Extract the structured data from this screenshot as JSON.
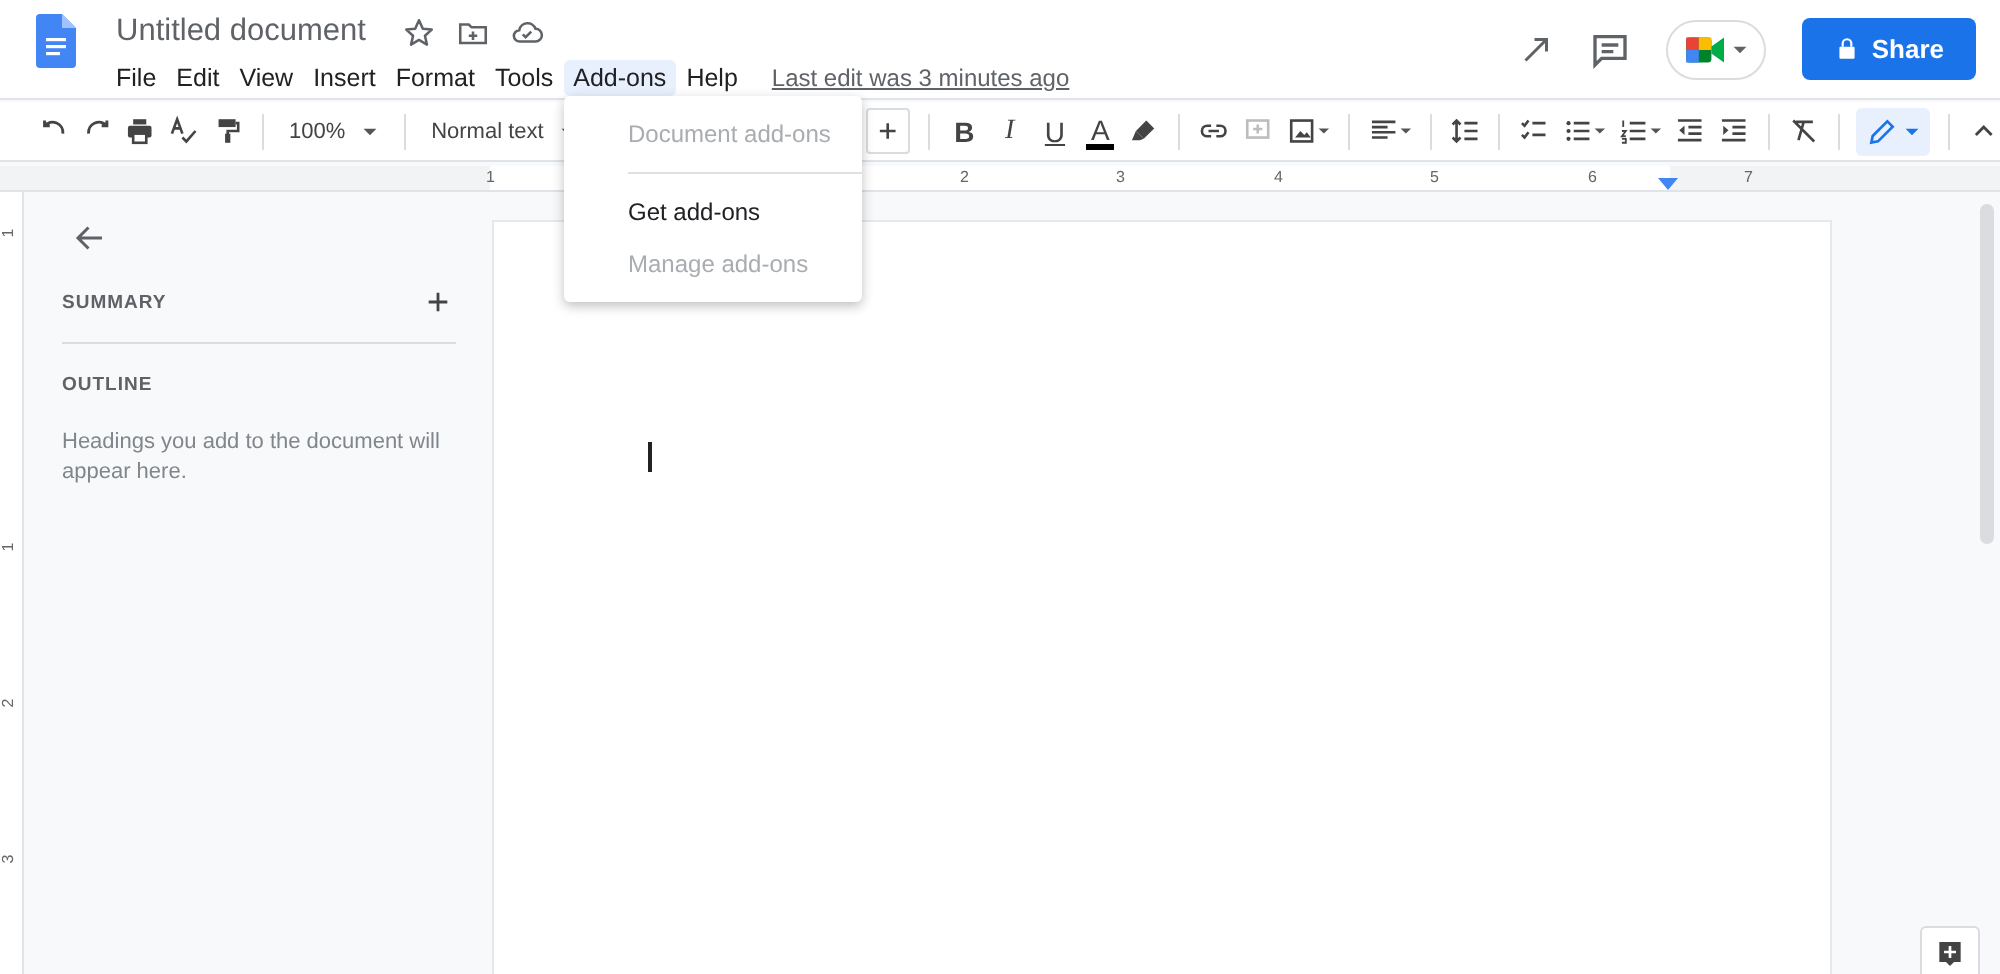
{
  "document": {
    "title": "Untitled document"
  },
  "menu_bar": [
    {
      "label": "File",
      "selected": false
    },
    {
      "label": "Edit",
      "selected": false
    },
    {
      "label": "View",
      "selected": false
    },
    {
      "label": "Insert",
      "selected": false
    },
    {
      "label": "Format",
      "selected": false
    },
    {
      "label": "Tools",
      "selected": false
    },
    {
      "label": "Add-ons",
      "selected": true
    },
    {
      "label": "Help",
      "selected": false
    }
  ],
  "last_edit": "Last edit was 3 minutes ago",
  "share_button": "Share",
  "toolbar": {
    "zoom": "100%",
    "style": "Normal text",
    "format_buttons": [
      {
        "kind": "bold",
        "glyph": "B"
      },
      {
        "kind": "italic",
        "glyph": "I"
      },
      {
        "kind": "underline",
        "glyph": "U"
      },
      {
        "kind": "color",
        "glyph": "A",
        "color": "#000000"
      }
    ],
    "add_comment_disabled": true,
    "editing_mode": {
      "selected": true
    }
  },
  "ruler": {
    "labels": [
      "1",
      "2",
      "3",
      "4",
      "5",
      "6",
      "7"
    ],
    "vertical_labels": [
      "1",
      "1",
      "2",
      "3"
    ]
  },
  "addons_menu": [
    {
      "label": "Document add-ons",
      "disabled": true
    },
    {
      "kind": "divider"
    },
    {
      "label": "Get add-ons",
      "disabled": false
    },
    {
      "label": "Manage add-ons",
      "disabled": true
    }
  ],
  "sidebar": {
    "summary": "SUMMARY",
    "outline": "OUTLINE",
    "outline_hint": "Headings you add to the document will appear here."
  }
}
